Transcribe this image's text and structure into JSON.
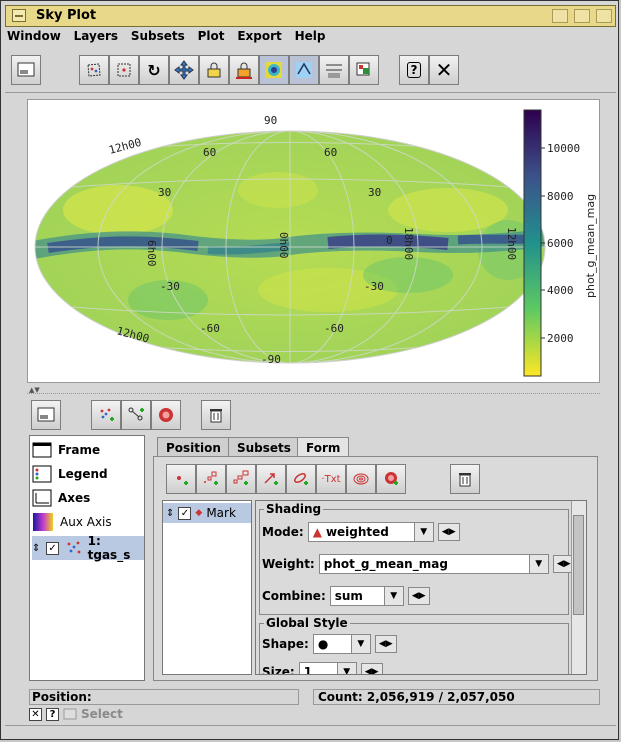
{
  "window": {
    "title": "Sky Plot"
  },
  "menu": [
    "Window",
    "Layers",
    "Subsets",
    "Plot",
    "Export",
    "Help"
  ],
  "plot": {
    "grid_labels_deg": [
      "90",
      "60",
      "60",
      "30",
      "30",
      "0",
      "-30",
      "-30",
      "-60",
      "-60",
      "-90"
    ],
    "ra_labels": [
      "12h00",
      "6h00",
      "0h00",
      "18h00",
      "12h00",
      "12h00"
    ],
    "colorbar_label": "phot_g_mean_mag",
    "colorbar_ticks": [
      "10000",
      "8000",
      "6000",
      "4000",
      "2000"
    ],
    "colorbar_colors": [
      "#2f004f",
      "#3b528b",
      "#21918c",
      "#5ec962",
      "#fde725"
    ]
  },
  "layers": {
    "items": [
      "Frame",
      "Legend",
      "Axes",
      "Aux Axis",
      "1: tgas_s"
    ]
  },
  "tabs": [
    "Position",
    "Subsets",
    "Form"
  ],
  "form": {
    "mark_label": "Mark",
    "shading_title": "Shading",
    "mode_label": "Mode:",
    "mode_value": "weighted",
    "weight_label": "Weight:",
    "weight_value": "phot_g_mean_mag",
    "combine_label": "Combine:",
    "combine_value": "sum",
    "global_title": "Global Style",
    "shape_label": "Shape:",
    "size_label": "Size:",
    "size_value": "1"
  },
  "status": {
    "position_label": "Position:",
    "count_text": "Count: 2,056,919 / 2,057,050",
    "select_label": "Select"
  }
}
